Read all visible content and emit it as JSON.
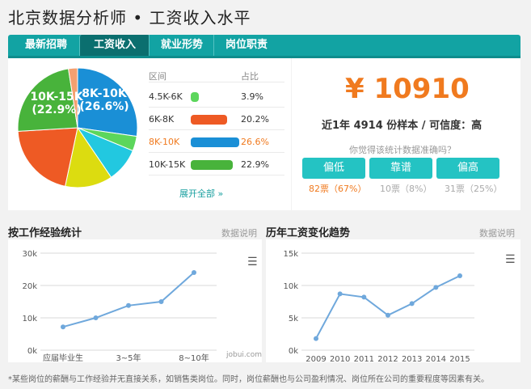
{
  "page_title": "北京数据分析师 • 工资收入水平",
  "tabs": [
    {
      "label": "最新招聘"
    },
    {
      "label": "工资收入"
    },
    {
      "label": "就业形势"
    },
    {
      "label": "岗位职责"
    }
  ],
  "distribution": {
    "header_range": "区间",
    "header_ratio": "占比",
    "rows": [
      {
        "range": "4.5K-6K",
        "ratio": "3.9%",
        "value": 3.9,
        "color": "#5cd65c"
      },
      {
        "range": "6K-8K",
        "ratio": "20.2%",
        "value": 20.2,
        "color": "#ee5a24"
      },
      {
        "range": "8K-10K",
        "ratio": "26.6%",
        "value": 26.6,
        "color": "#1a8fd6"
      },
      {
        "range": "10K-15K",
        "ratio": "22.9%",
        "value": 22.9,
        "color": "#48b33b"
      }
    ],
    "expand_link": "展开全部 »",
    "pie_label_1_range": "10K-15K",
    "pie_label_1_pct": "(22.9%)",
    "pie_label_2_range": "8K-10K",
    "pie_label_2_pct": "(26.6%)"
  },
  "summary": {
    "salary": "¥ 10910",
    "sample_text": "近1年 4914 份样本 / 可信度：高",
    "question": "你觉得该统计数据准确吗？",
    "vote_buttons": [
      {
        "label": "偏低",
        "count": "82票（67%）"
      },
      {
        "label": "靠谱",
        "count": "10票（8%）"
      },
      {
        "label": "偏高",
        "count": "31票（25%）"
      }
    ]
  },
  "experience_section": {
    "title": "按工作经验统计",
    "link": "数据说明"
  },
  "trend_section": {
    "title": "历年工资变化趋势",
    "link": "数据说明"
  },
  "watermark": "jobui.com",
  "footnote": "*某些岗位的薪酬与工作经验并无直接关系，如销售类岗位。同时，岗位薪酬也与公司盈利情况、岗位所在公司的重要程度等因素有关。",
  "chart_data": [
    {
      "type": "pie",
      "categories": [
        "4.5K-6K",
        "6K-8K",
        "8K-10K",
        "10K-15K",
        "other-yellow",
        "other-cyan",
        "other-salmon"
      ],
      "values": [
        3.9,
        20.2,
        26.6,
        22.9,
        12.5,
        9.0,
        2.4
      ],
      "colors": [
        "#5cd65c",
        "#ee5a24",
        "#1a8fd6",
        "#48b33b",
        "#dcdc10",
        "#22c8e0",
        "#f4a070"
      ]
    },
    {
      "type": "line",
      "categories": [
        "应届毕业生",
        "",
        "3-5年",
        "",
        "8-10年"
      ],
      "x_tick_labels": [
        "应届毕业生",
        "3~5年",
        "8~10年"
      ],
      "values": [
        7200,
        10000,
        13800,
        15000,
        24000
      ],
      "y_ticks": [
        "0k",
        "10k",
        "20k",
        "30k"
      ],
      "ylim": [
        0,
        30000
      ],
      "color": "#6fa8dc"
    },
    {
      "type": "line",
      "categories": [
        "2009",
        "2010",
        "2011",
        "2012",
        "2013",
        "2014",
        "2015"
      ],
      "values": [
        1800,
        8700,
        8200,
        5400,
        7200,
        9700,
        11500
      ],
      "y_ticks": [
        "0k",
        "5k",
        "10k",
        "15k"
      ],
      "ylim": [
        0,
        15000
      ],
      "color": "#6fa8dc"
    }
  ]
}
